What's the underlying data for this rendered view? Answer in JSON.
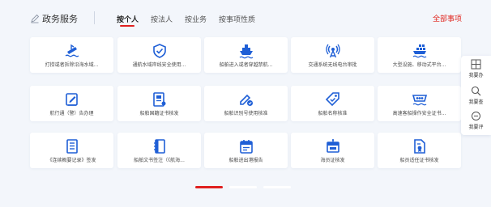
{
  "header": {
    "title": "政务服务",
    "tabs": [
      {
        "label": "按个人",
        "active": true
      },
      {
        "label": "按法人"
      },
      {
        "label": "按业务"
      },
      {
        "label": "按事项性质"
      }
    ],
    "all_link": "全部事项"
  },
  "grid": {
    "rows": [
      [
        {
          "label": "打捞或者拆除沿海水域...",
          "icon": "sinking-ship-icon"
        },
        {
          "label": "通航水域岸线安全使用...",
          "icon": "shield-check-icon"
        },
        {
          "label": "船舶进入或者穿越禁航...",
          "icon": "ship-icon"
        },
        {
          "label": "交通系统无线电台审批",
          "icon": "radio-tower-icon"
        },
        {
          "label": "大型设施、移动式平台...",
          "icon": "cargo-ship-icon"
        }
      ],
      [
        {
          "label": "航行通（警）告办理",
          "icon": "notice-edit-icon"
        },
        {
          "label": "船舶国籍证书核发",
          "icon": "certificate-icon"
        },
        {
          "label": "船舶识别号使用核准",
          "icon": "approval-pen-icon"
        },
        {
          "label": "船舶名称核准",
          "icon": "name-tag-icon"
        },
        {
          "label": "高速客船操作安全证书...",
          "icon": "speedboat-icon"
        }
      ],
      [
        {
          "label": "《连续概要记录》签发",
          "icon": "record-doc-icon"
        },
        {
          "label": "船舶文书签注（《航海...",
          "icon": "book-icon"
        },
        {
          "label": "船舶进出港报告",
          "icon": "calendar-report-icon"
        },
        {
          "label": "海员证核发",
          "icon": "id-card-icon"
        },
        {
          "label": "船员适任证书核发",
          "icon": "qualification-doc-icon"
        }
      ]
    ]
  },
  "pager": {
    "pages": 3,
    "active": 0
  },
  "side_menu": {
    "items": [
      {
        "label": "我要办",
        "icon": "grid-panel-icon"
      },
      {
        "label": "我要查",
        "icon": "search-icon"
      },
      {
        "label": "我要评",
        "icon": "comment-icon"
      }
    ]
  },
  "colors": {
    "accent": "#e02020",
    "icon_blue": "#1f5fd6",
    "background": "#f3f6fb"
  }
}
